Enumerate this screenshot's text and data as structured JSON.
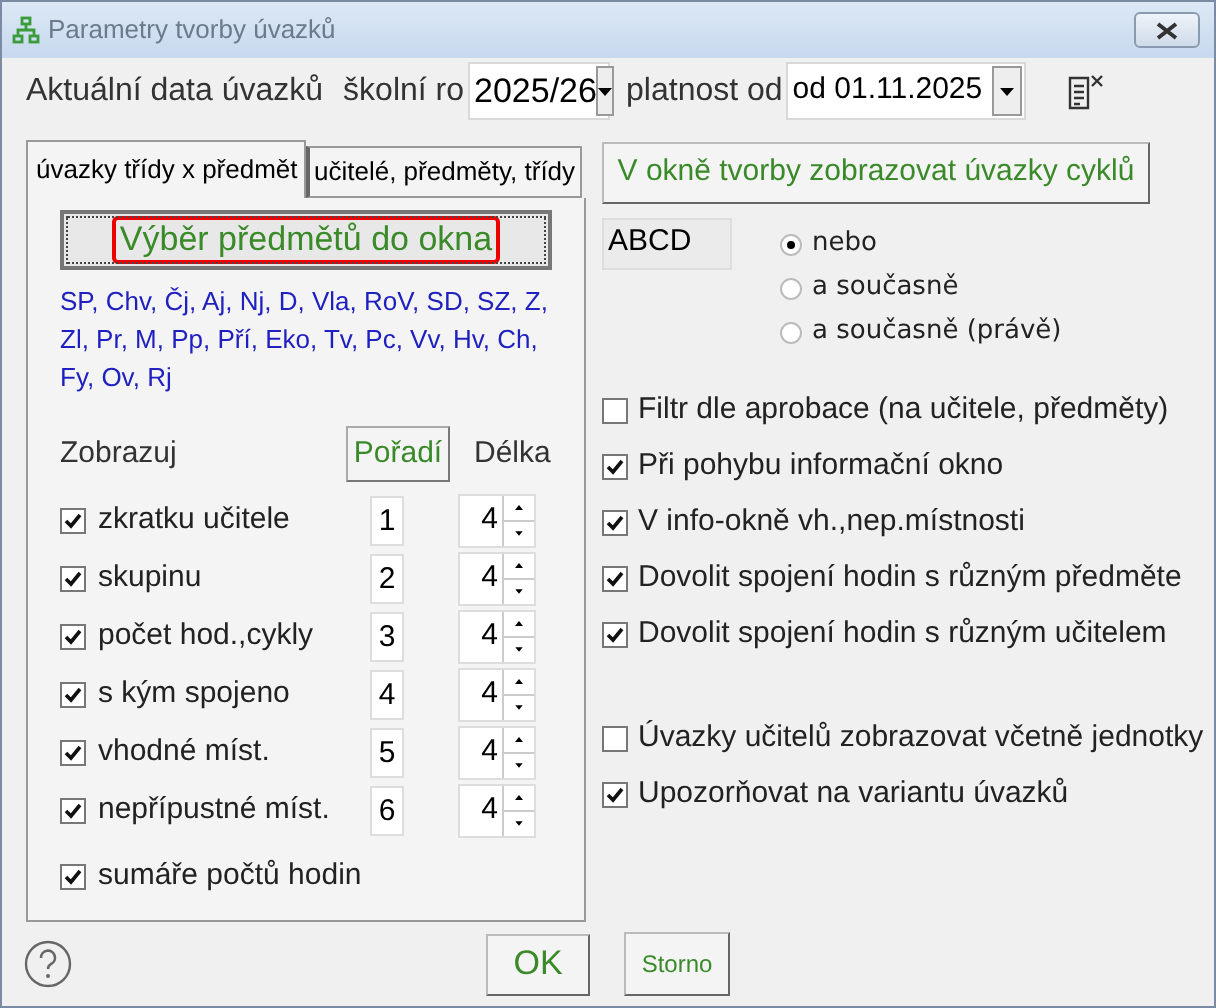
{
  "window": {
    "title": "Parametry tvorby úvazků"
  },
  "header": {
    "label": "Aktuální data úvazků",
    "school_year": {
      "label": "školní ro",
      "value": "2025/26"
    },
    "validity": {
      "label": "platnost od",
      "value": "od 01.11.2025"
    }
  },
  "tabs": [
    {
      "label": "úvazky třídy x předmět",
      "selected": true
    },
    {
      "label": "učitelé, předměty, třídy",
      "selected": false
    }
  ],
  "subjects_button": "Výběr předmětů do okna",
  "subjects": "SP, Chv, Čj, Aj, Nj, D, Vla, RoV, SD, SZ, Z, Zl, Pr, M, Pp, Pří, Eko, Tv, Pc, Vv, Hv, Ch, Fy, Ov, Rj",
  "display": {
    "heading": "Zobrazuj",
    "order_button": "Pořadí",
    "length_heading": "Délka",
    "rows": [
      {
        "label": "zkratku učitele",
        "checked": true,
        "order": "1",
        "length": "4"
      },
      {
        "label": "skupinu",
        "checked": true,
        "order": "2",
        "length": "4"
      },
      {
        "label": "počet hod.,cykly",
        "checked": true,
        "order": "3",
        "length": "4"
      },
      {
        "label": "s kým spojeno",
        "checked": true,
        "order": "4",
        "length": "4"
      },
      {
        "label": "vhodné míst.",
        "checked": true,
        "order": "5",
        "length": "4"
      },
      {
        "label": "nepřípustné míst.",
        "checked": true,
        "order": "6",
        "length": "4"
      }
    ],
    "summary": {
      "label": "sumáře počtů hodin",
      "checked": true
    }
  },
  "cycle_button": "V okně tvorby zobrazovat úvazky cyklů",
  "pattern_label": "ABCD",
  "modes": [
    {
      "label": "nebo",
      "selected": true
    },
    {
      "label": "a současně",
      "selected": false
    },
    {
      "label": "a současně (právě)",
      "selected": false
    }
  ],
  "options": [
    {
      "label": "Filtr dle aprobace (na učitele, předměty)",
      "checked": false
    },
    {
      "label": "Při pohybu informační okno",
      "checked": true
    },
    {
      "label": "V info-okně vh.,nep.místnosti",
      "checked": true
    },
    {
      "label": "Dovolit spojení hodin s různým předměte",
      "checked": true
    },
    {
      "label": "Dovolit spojení hodin s různým učitelem",
      "checked": true
    }
  ],
  "more_options": [
    {
      "label": "Úvazky učitelů zobrazovat včetně jednotky",
      "checked": false
    },
    {
      "label": "Upozorňovat na variantu úvazků",
      "checked": true
    }
  ],
  "buttons": {
    "ok": "OK",
    "cancel": "Storno"
  }
}
